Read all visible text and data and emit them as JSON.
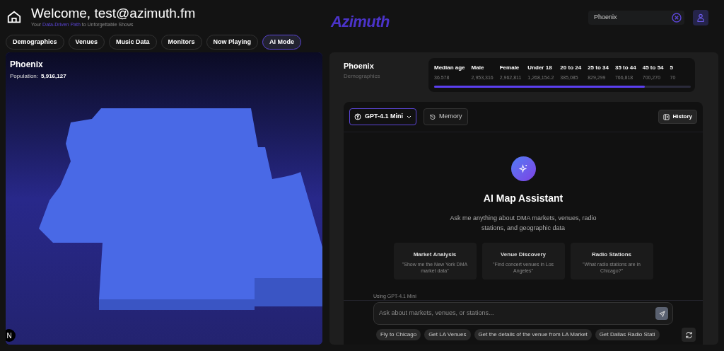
{
  "header": {
    "title": "Welcome, test@azimuth.fm",
    "subtitle": "Your **Data-Driven Path** to Unforgettable Shows",
    "logo": "Azimuth",
    "search": {
      "value": "Phoenix"
    }
  },
  "tabs": [
    {
      "label": "Demographics",
      "selected": false
    },
    {
      "label": "Venues",
      "selected": false
    },
    {
      "label": "Music Data",
      "selected": false
    },
    {
      "label": "Monitors",
      "selected": false
    },
    {
      "label": "Now Playing",
      "selected": false
    },
    {
      "label": "AI Mode",
      "selected": true
    }
  ],
  "map": {
    "title": "Phoenix",
    "population_label": "Population:",
    "population": "5,916,127",
    "badge": "N"
  },
  "demographics": {
    "title": "Phoenix",
    "subtitle": "Demographics",
    "stats": [
      {
        "label": "Median age",
        "value": "36.578"
      },
      {
        "label": "Male",
        "value": "2,953,316"
      },
      {
        "label": "Female",
        "value": "2,962,811"
      },
      {
        "label": "Under 18",
        "value": "1,268,154.2"
      },
      {
        "label": "20 to 24",
        "value": "385,085"
      },
      {
        "label": "25 to 34",
        "value": "829,299"
      },
      {
        "label": "35 to 44",
        "value": "766,818"
      },
      {
        "label": "45 to 54",
        "value": "700,270"
      },
      {
        "label": "5",
        "value": "70"
      }
    ]
  },
  "assistant": {
    "model": "GPT-4.1 Mini",
    "memory": "Memory",
    "history": "History",
    "title": "AI Map Assistant",
    "description": "Ask me anything about DMA markets, venues, radio stations, and geographic data",
    "cards": [
      {
        "title": "Market Analysis",
        "example": "\"Show me the New York DMA market data\""
      },
      {
        "title": "Venue Discovery",
        "example": "\"Find concert venues in Los Angeles\""
      },
      {
        "title": "Radio Stations",
        "example": "\"What radio stations are in Chicago?\""
      }
    ],
    "using": "Using GPT-4.1 Mini",
    "placeholder": "Ask about markets, venues, or stations...",
    "suggestions": [
      "Fly to Chicago",
      "Get LA Venues",
      "Get the details of the venue from LA Market",
      "Get Dallas Radio Stati"
    ]
  }
}
